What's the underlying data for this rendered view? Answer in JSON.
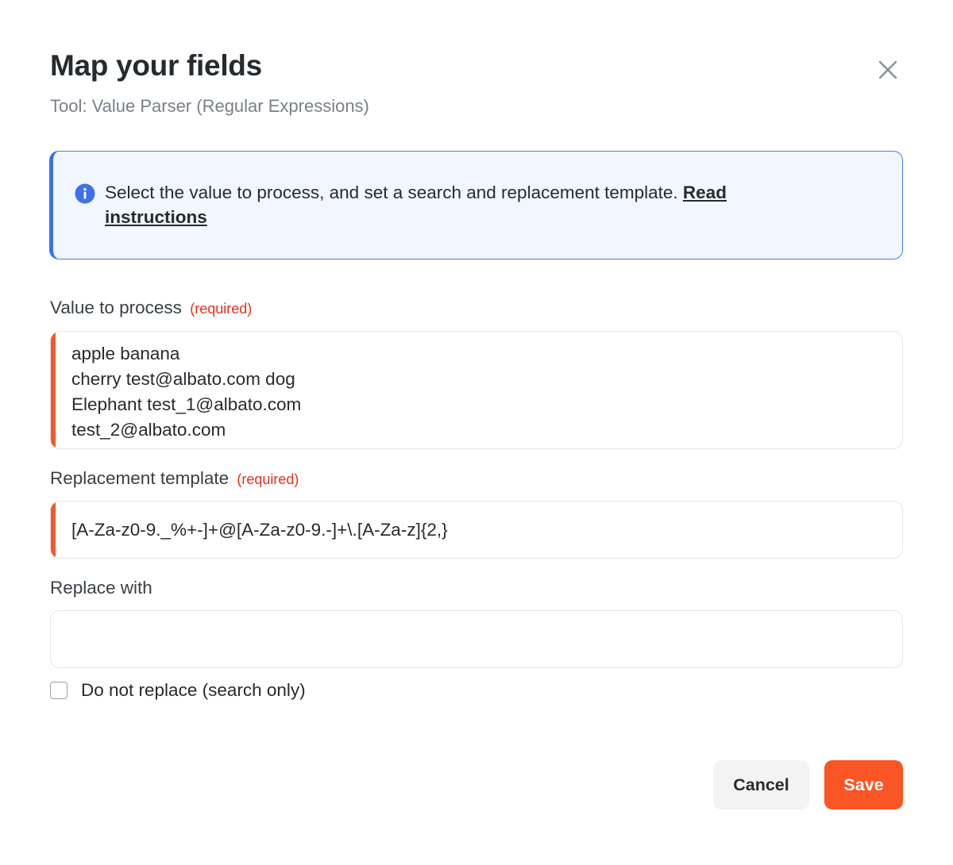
{
  "dialog": {
    "title": "Map your fields",
    "subtitle": "Tool: Value Parser (Regular Expressions)",
    "close_icon": "close-icon"
  },
  "info": {
    "icon": "info-icon",
    "text": "Select the value to process, and set a search and replacement template. ",
    "link_text": "Read instructions",
    "accent_color": "#3e72e6"
  },
  "fields": {
    "value_to_process": {
      "label": "Value to process",
      "required_label": "(required)",
      "lines": [
        "apple banana",
        "cherry test@albato.com dog",
        "Elephant test_1@albato.com",
        "test_2@albato.com"
      ]
    },
    "replacement_template": {
      "label": "Replacement template",
      "required_label": "(required)",
      "value": "[A-Za-z0-9._%+-]+@[A-Za-z0-9.-]+\\.[A-Za-z]{2,}"
    },
    "replace_with": {
      "label": "Replace with",
      "value": ""
    }
  },
  "checkbox": {
    "label": "Do not replace (search only)",
    "checked": false
  },
  "buttons": {
    "cancel": "Cancel",
    "save": "Save",
    "save_color": "#fa5524"
  },
  "colors": {
    "required": "#e2301c",
    "invalid_marker": "#f4582b"
  }
}
